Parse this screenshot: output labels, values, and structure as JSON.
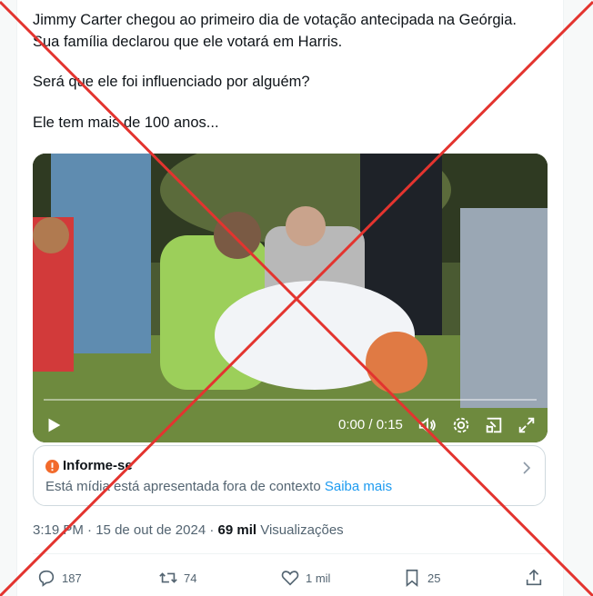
{
  "tweet": {
    "line1": "Jimmy Carter chegou ao primeiro dia de votação antecipada na Geórgia.",
    "line2": "Sua família declarou que ele votará em Harris.",
    "line3": "Será que ele foi influenciado por alguém?",
    "line4": "Ele tem mais de 100 anos..."
  },
  "video": {
    "time": "0:00 / 0:15",
    "icons": [
      "play-icon",
      "volume-icon",
      "settings-icon",
      "pip-icon",
      "fullscreen-icon"
    ]
  },
  "notice": {
    "title": "Informe-se",
    "body": "Está mídia está apresentada fora de contexto",
    "link": "Saiba mais"
  },
  "meta": {
    "time": "3:19 PM",
    "sep1": "·",
    "date": "15 de out de 2024",
    "sep2": "·",
    "views_count": "69 mil",
    "views_label": "Visualizações"
  },
  "actions": {
    "replies": "187",
    "reposts": "74",
    "likes": "1 mil",
    "bookmarks": "25"
  },
  "colors": {
    "accent": "#1d9bf0",
    "warning": "#f26a2b",
    "cross": "#e3342f"
  }
}
